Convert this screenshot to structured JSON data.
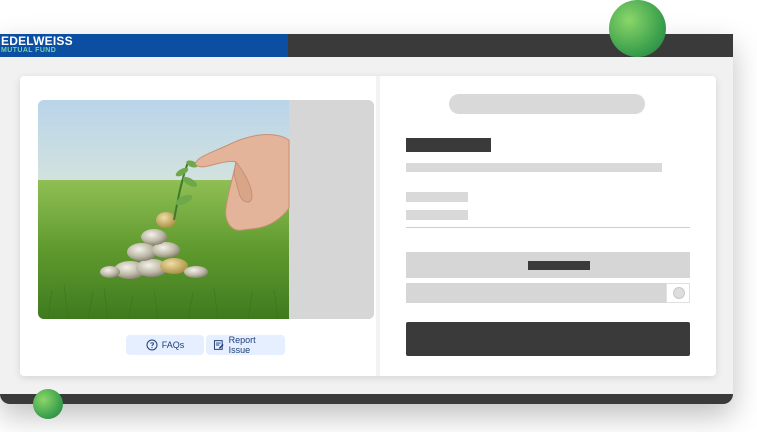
{
  "brand": {
    "name": "EDELWEISS",
    "subtitle": "MUTUAL FUND",
    "colors": {
      "bar": "#0b4ea2",
      "subtitle": "#6fd3a8"
    }
  },
  "hero": {
    "image": "hand-planting-seedling-on-coins",
    "icon": "growth-illustration"
  },
  "footer_links": {
    "faqs": {
      "label": "FAQs",
      "icon": "question-circle-icon"
    },
    "report": {
      "label": "Report Issue",
      "icon": "edit-note-icon"
    }
  },
  "theme": {
    "accent_green": "#3fa34d",
    "skeleton": "#d9d9d9",
    "skeleton_dark": "#3a3a3a",
    "chip_bg": "#e6efff"
  }
}
